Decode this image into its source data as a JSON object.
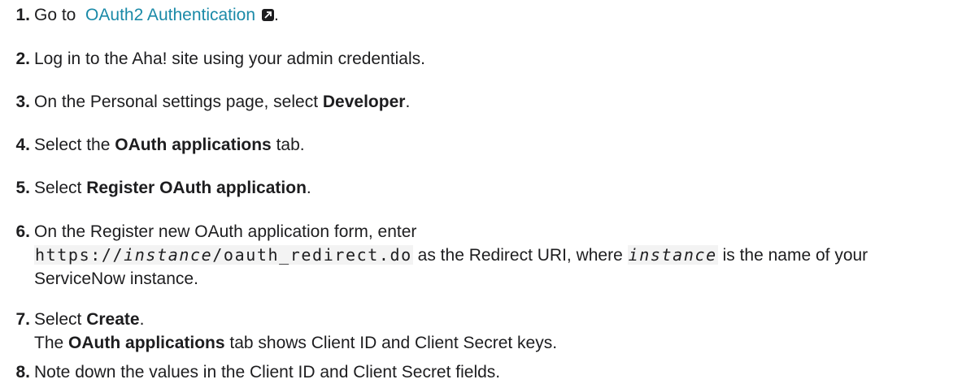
{
  "steps": [
    {
      "num": "1.",
      "prefix": "Go to",
      "link": "OAuth2 Authentication",
      "link_icon": "external-link-icon",
      "suffix": "."
    },
    {
      "num": "2.",
      "text": "Log in to the Aha! site using your admin credentials."
    },
    {
      "num": "3.",
      "prefix": "On the Personal settings page, select ",
      "bold": "Developer",
      "suffix": "."
    },
    {
      "num": "4.",
      "prefix": "Select the ",
      "bold": "OAuth applications",
      "suffix": " tab."
    },
    {
      "num": "5.",
      "prefix": "Select ",
      "bold": "Register OAuth application",
      "suffix": "."
    },
    {
      "num": "6.",
      "prefix": "On the Register new OAuth application form, enter",
      "code_a": "https://",
      "code_var": "instance",
      "code_b": "/oauth_redirect.do",
      "mid": " as the Redirect URI, where ",
      "var": "instance",
      "suffix": " is the name of your ServiceNow instance."
    },
    {
      "num": "7.",
      "prefix": "Select ",
      "bold": "Create",
      "suffix": ".",
      "line2_prefix": "The ",
      "line2_bold": "OAuth applications",
      "line2_suffix": " tab shows Client ID and Client Secret keys."
    },
    {
      "num": "8.",
      "text": "Note down the values in the Client ID and Client Secret fields."
    }
  ]
}
